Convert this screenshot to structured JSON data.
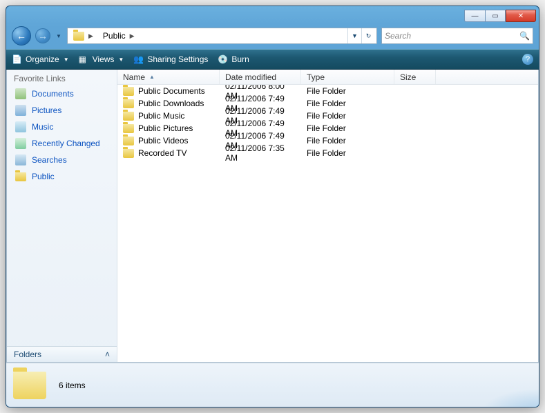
{
  "breadcrumb": {
    "location": "Public"
  },
  "search": {
    "placeholder": "Search"
  },
  "toolbar": {
    "organize": "Organize",
    "views": "Views",
    "sharing": "Sharing Settings",
    "burn": "Burn"
  },
  "sidebar": {
    "heading": "Favorite Links",
    "items": [
      {
        "label": "Documents"
      },
      {
        "label": "Pictures"
      },
      {
        "label": "Music"
      },
      {
        "label": "Recently Changed"
      },
      {
        "label": "Searches"
      },
      {
        "label": "Public"
      }
    ],
    "folders_label": "Folders"
  },
  "columns": {
    "name": "Name",
    "date": "Date modified",
    "type": "Type",
    "size": "Size"
  },
  "rows": [
    {
      "name": "Public Documents",
      "date": "02/11/2006 8:00 AM",
      "type": "File Folder"
    },
    {
      "name": "Public Downloads",
      "date": "02/11/2006 7:49 AM",
      "type": "File Folder"
    },
    {
      "name": "Public Music",
      "date": "02/11/2006 7:49 AM",
      "type": "File Folder"
    },
    {
      "name": "Public Pictures",
      "date": "02/11/2006 7:49 AM",
      "type": "File Folder"
    },
    {
      "name": "Public Videos",
      "date": "02/11/2006 7:49 AM",
      "type": "File Folder"
    },
    {
      "name": "Recorded TV",
      "date": "02/11/2006 7:35 AM",
      "type": "File Folder"
    }
  ],
  "details": {
    "summary": "6 items"
  }
}
